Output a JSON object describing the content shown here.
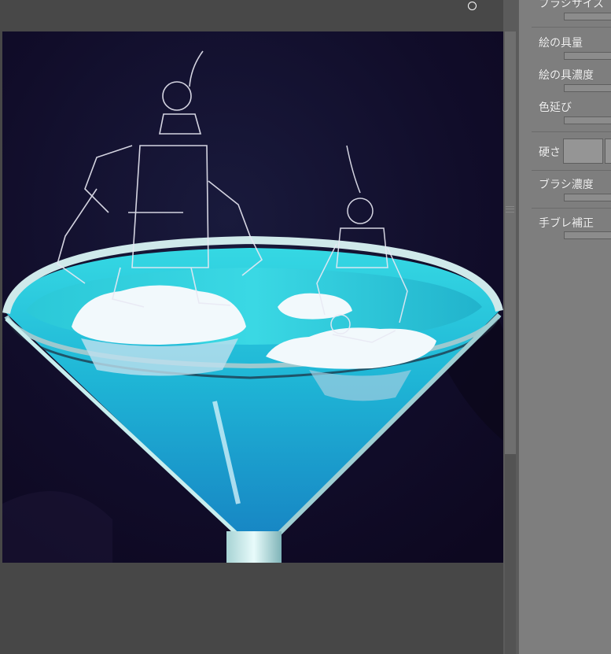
{
  "brush_properties": {
    "brush_size": "ブラシサイズ",
    "paint_amount": "絵の具量",
    "paint_density": "絵の具濃度",
    "color_stretch": "色延び",
    "hardness": "硬さ",
    "brush_density": "ブラシ濃度",
    "stabilization": "手ブレ補正"
  },
  "colors": {
    "workspace": "#474747",
    "panel": "#7e7e7e",
    "night_sky": "#120f2c",
    "cocktail": "#22c4d8"
  },
  "icons": {
    "cursor": "brush-cursor-circle-icon",
    "grip": "splitter-grip-icon"
  }
}
